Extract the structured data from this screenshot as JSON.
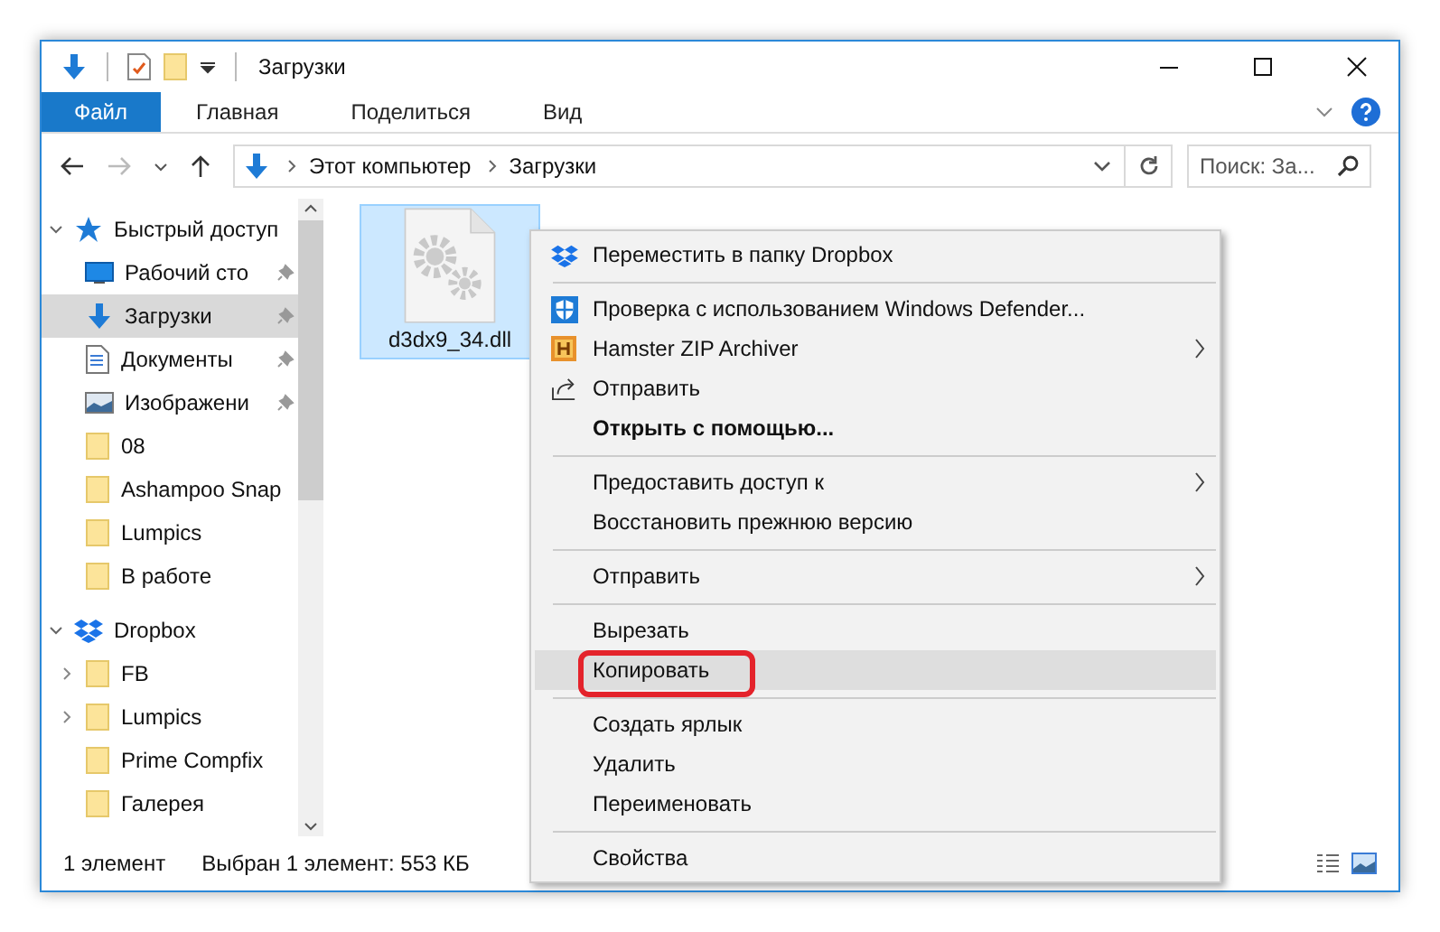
{
  "window": {
    "title": "Загрузки"
  },
  "ribbon_tabs": [
    {
      "label": "Файл",
      "selected": true
    },
    {
      "label": "Главная",
      "selected": false
    },
    {
      "label": "Поделиться",
      "selected": false
    },
    {
      "label": "Вид",
      "selected": false
    }
  ],
  "address": {
    "crumbs": [
      "Этот компьютер",
      "Загрузки"
    ]
  },
  "search": {
    "placeholder": "Поиск: За..."
  },
  "sidebar": {
    "items": [
      {
        "label": "Быстрый доступ",
        "kind": "star",
        "expanded": true,
        "children": [
          {
            "label": "Рабочий сто",
            "kind": "desktop",
            "pinned": true,
            "selected": false
          },
          {
            "label": "Загрузки",
            "kind": "downloads",
            "pinned": true,
            "selected": true
          },
          {
            "label": "Документы",
            "kind": "document",
            "pinned": true,
            "selected": false
          },
          {
            "label": "Изображени",
            "kind": "pictures",
            "pinned": true,
            "selected": false
          },
          {
            "label": "08",
            "kind": "folder",
            "pinned": false,
            "selected": false
          },
          {
            "label": "Ashampoo Snap",
            "kind": "folder",
            "pinned": false,
            "selected": false
          },
          {
            "label": "Lumpics",
            "kind": "folder",
            "pinned": false,
            "selected": false
          },
          {
            "label": "В работе",
            "kind": "folder",
            "pinned": false,
            "selected": false
          }
        ]
      },
      {
        "label": "Dropbox",
        "kind": "dropbox",
        "expanded": true,
        "children": [
          {
            "label": "FB",
            "kind": "folder",
            "expandable": true,
            "selected": false
          },
          {
            "label": "Lumpics",
            "kind": "folder",
            "expandable": true,
            "selected": false
          },
          {
            "label": "Prime Compfix",
            "kind": "folder",
            "expandable": false,
            "selected": false
          },
          {
            "label": "Галерея",
            "kind": "folder",
            "expandable": false,
            "selected": false
          }
        ]
      }
    ]
  },
  "files": [
    {
      "name": "d3dx9_34.dll",
      "selected": true
    }
  ],
  "context_menu": [
    {
      "kind": "dropbox",
      "label": "Переместить в папку Dropbox",
      "submenu": false,
      "bold": false,
      "highlighted": false
    },
    {
      "kind": "separator"
    },
    {
      "kind": "shield",
      "label": "Проверка с использованием Windows Defender...",
      "submenu": false,
      "bold": false,
      "highlighted": false
    },
    {
      "kind": "archive",
      "label": "Hamster ZIP Archiver",
      "submenu": true,
      "bold": false,
      "highlighted": false
    },
    {
      "kind": "share",
      "label": "Отправить",
      "submenu": false,
      "bold": false,
      "highlighted": false
    },
    {
      "kind": "item",
      "label": "Открыть с помощью...",
      "submenu": false,
      "bold": true,
      "highlighted": false
    },
    {
      "kind": "separator"
    },
    {
      "kind": "item",
      "label": "Предоставить доступ к",
      "submenu": true,
      "bold": false,
      "highlighted": false
    },
    {
      "kind": "item",
      "label": "Восстановить прежнюю версию",
      "submenu": false,
      "bold": false,
      "highlighted": false
    },
    {
      "kind": "separator"
    },
    {
      "kind": "item",
      "label": "Отправить",
      "submenu": true,
      "bold": false,
      "highlighted": false
    },
    {
      "kind": "separator"
    },
    {
      "kind": "item",
      "label": "Вырезать",
      "submenu": false,
      "bold": false,
      "highlighted": false
    },
    {
      "kind": "item",
      "label": "Копировать",
      "submenu": false,
      "bold": false,
      "highlighted": true
    },
    {
      "kind": "separator"
    },
    {
      "kind": "item",
      "label": "Создать ярлык",
      "submenu": false,
      "bold": false,
      "highlighted": false
    },
    {
      "kind": "item",
      "label": "Удалить",
      "submenu": false,
      "bold": false,
      "highlighted": false
    },
    {
      "kind": "item",
      "label": "Переименовать",
      "submenu": false,
      "bold": false,
      "highlighted": false
    },
    {
      "kind": "separator"
    },
    {
      "kind": "item",
      "label": "Свойства",
      "submenu": false,
      "bold": false,
      "highlighted": false
    }
  ],
  "status_bar": {
    "count": "1 элемент",
    "selection": "Выбран 1 элемент: 553 КБ"
  }
}
